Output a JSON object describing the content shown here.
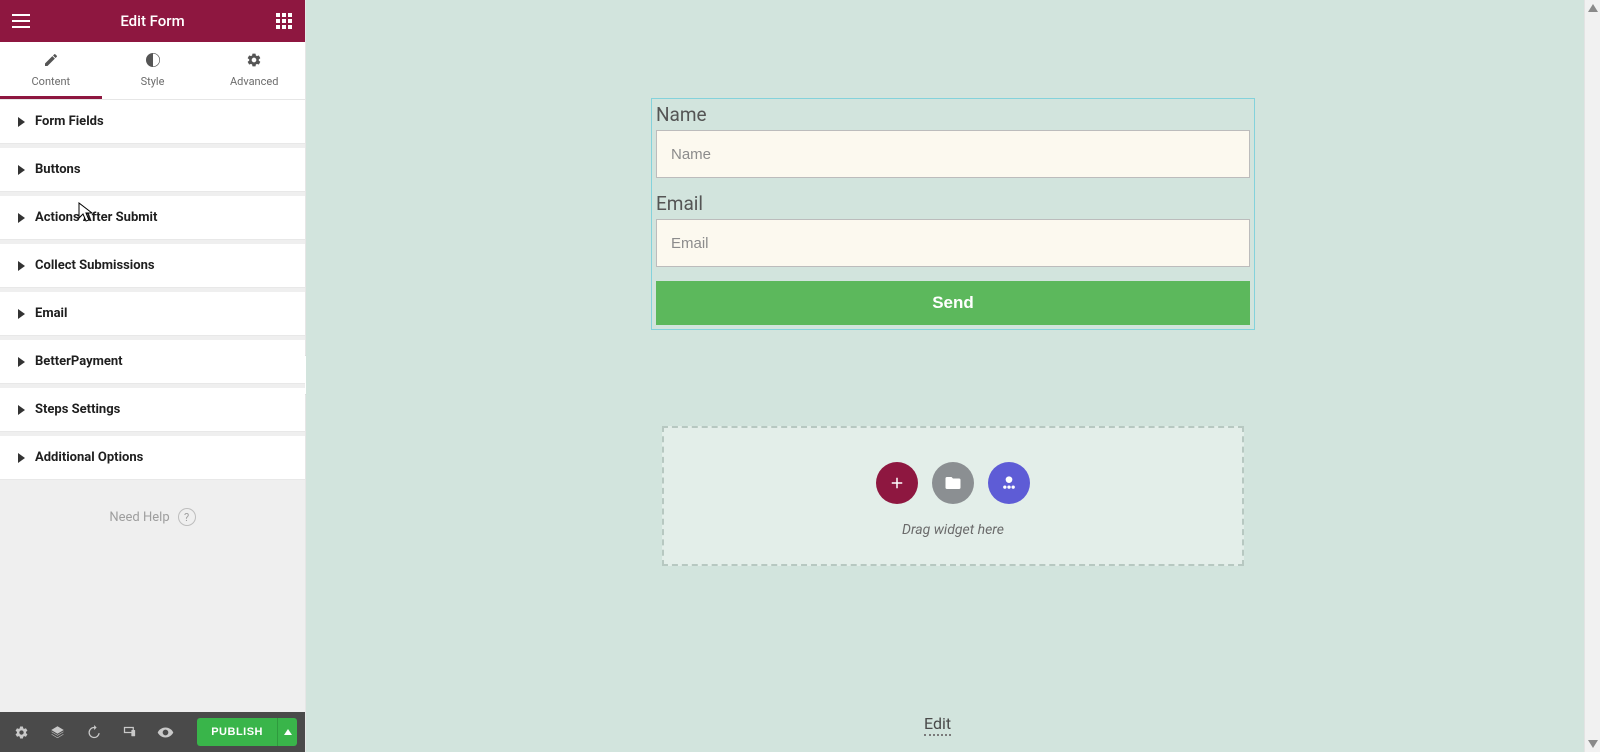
{
  "panel": {
    "title": "Edit Form",
    "tabs": [
      {
        "label": "Content"
      },
      {
        "label": "Style"
      },
      {
        "label": "Advanced"
      }
    ],
    "sections": [
      {
        "label": "Form Fields"
      },
      {
        "label": "Buttons"
      },
      {
        "label": "Actions After Submit"
      },
      {
        "label": "Collect Submissions"
      },
      {
        "label": "Email"
      },
      {
        "label": "BetterPayment"
      },
      {
        "label": "Steps Settings"
      },
      {
        "label": "Additional Options"
      }
    ],
    "help": "Need Help",
    "publish": "PUBLISH"
  },
  "form": {
    "name_label": "Name",
    "name_placeholder": "Name",
    "email_label": "Email",
    "email_placeholder": "Email",
    "send_label": "Send"
  },
  "dropzone": {
    "hint": "Drag widget here"
  },
  "footer_link": "Edit"
}
